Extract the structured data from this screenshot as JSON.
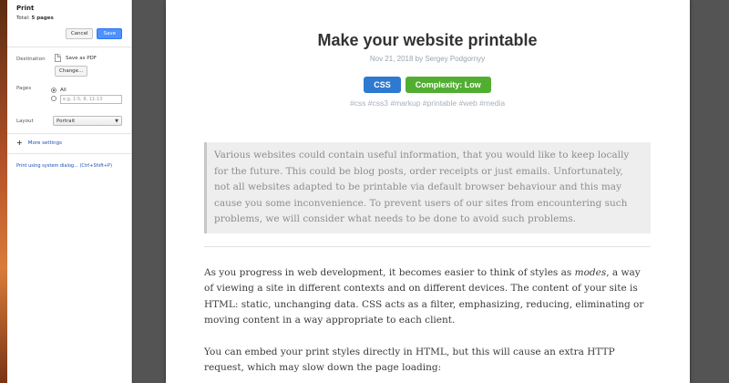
{
  "sidebar": {
    "title": "Print",
    "total_label": "Total:",
    "total_value": "5 pages",
    "cancel_label": "Cancel",
    "save_label": "Save",
    "destination": {
      "label": "Destination",
      "value": "Save as PDF",
      "change_label": "Change..."
    },
    "pages": {
      "label": "Pages",
      "all_label": "All",
      "range_placeholder": "e.g. 1-5, 8, 11-13"
    },
    "layout": {
      "label": "Layout",
      "selected": "Portrait"
    },
    "more_settings_label": "More settings",
    "system_dialog_label": "Print using system dialog... (Ctrl+Shift+P)"
  },
  "article": {
    "title": "Make your website printable",
    "meta": "Nov 21, 2018 by Sergey Podgornyy",
    "badges": [
      "CSS",
      "Complexity: Low"
    ],
    "tags": "#css #css3 #markup #printable #web #media",
    "intro": "Various websites could contain useful information, that you would like to keep locally for the future. This could be blog posts, order receipts or just emails. Unfortunately, not all websites adapted to be printable via default browser behaviour and this may cause you some inconvenience. To prevent users of our sites from encountering such problems, we will consider what needs to be done to avoid such problems.",
    "para1_before": "As you progress in web development, it becomes easier to think of styles as ",
    "para1_em": "modes",
    "para1_after": ", a way of viewing a site in different contexts and on different devices. The content of your site is HTML: static, unchanging data. CSS acts as a filter, emphasizing, reducing, eliminating or moving content in a way appropriate to each client.",
    "para2": "You can embed your print styles directly in HTML, but this will cause an extra HTTP request, which may slow down the page loading:"
  },
  "colors": {
    "save_button": "#4d90fe",
    "badge_css": "#2e7ad1",
    "badge_complexity": "#52ae32",
    "link": "#1a4fb8"
  }
}
